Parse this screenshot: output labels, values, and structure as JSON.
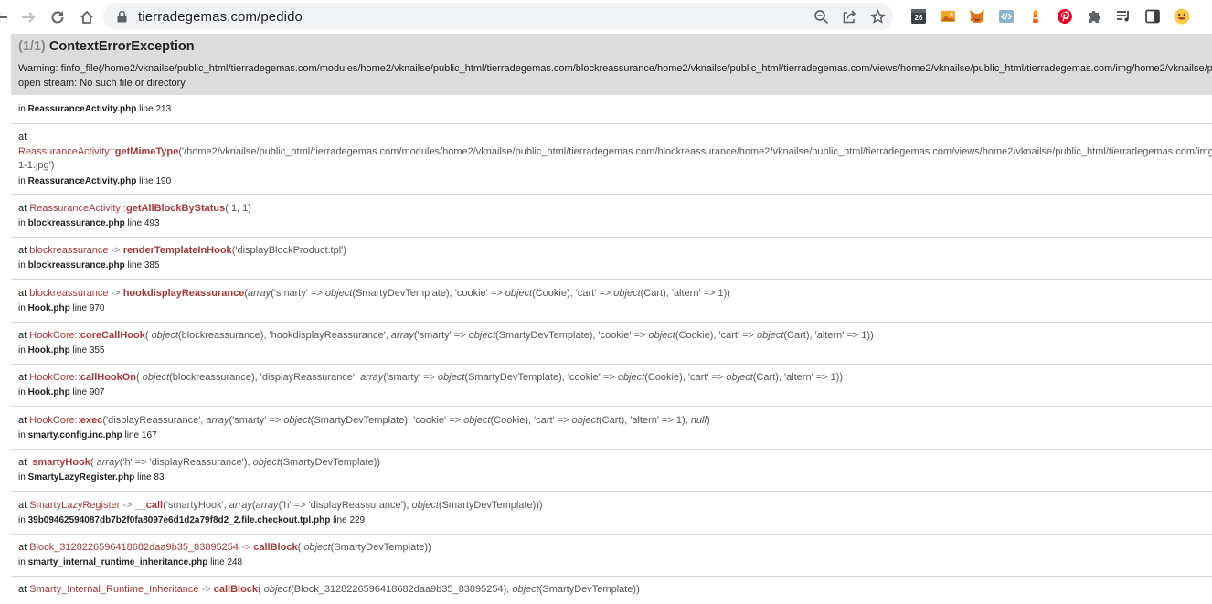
{
  "browser": {
    "url": "tierradegemas.com/pedido",
    "extensions": [
      "calendar-26-icon",
      "image-extension-icon",
      "metamask-fox-icon",
      "code-view-icon",
      "tower-extension-icon",
      "pinterest-icon",
      "puzzle-extensions-icon"
    ],
    "calendar_badge": "26"
  },
  "error": {
    "count": "(1/1)",
    "title": "ContextErrorException",
    "message_line1": "Warning: finfo_file(/home2/vknailse/public_html/tierradegemas.com/modules/home2/vknailse/public_html/tierradegemas.com/blockreassurance/home2/vknailse/public_html/tierradegemas.com/views/home2/vknailse/public_html/tierradegemas.com/img/home2/vknailse/public_html/tierradegemas.com/",
    "message_line2": "open stream: No such file or directory"
  },
  "trace": {
    "t0": {
      "in": "in",
      "file": "ReassuranceActivity.php",
      "line": "line 213"
    },
    "t1": {
      "at": "at",
      "cls": "ReassuranceActivity",
      "op": "::",
      "fn": "getMimeType",
      "args": "('/home2/vknailse/public_html/tierradegemas.com/modules/home2/vknailse/public_html/tierradegemas.com/blockreassurance/home2/vknailse/public_html/tierradegemas.com/views/home2/vknailse/public_html/tierradegemas.com/img/",
      "args2": "1-1.jpg')",
      "file": "ReassuranceActivity.php",
      "line": "line 190"
    },
    "t2": {
      "cls": "ReassuranceActivity",
      "op": "::",
      "fn": "getAllBlockByStatus",
      "args": "( 1, 1)",
      "file": "blockreassurance.php",
      "line": "line 493"
    },
    "t3": {
      "cls": "blockreassurance",
      "op": "->",
      "fn": "renderTemplateInHook",
      "args": "('displayBlockProduct.tpl')",
      "file": "blockreassurance.php",
      "line": "line 385"
    },
    "t4": {
      "cls": "blockreassurance",
      "op": "->",
      "fn": "hookdisplayReassurance",
      "a1": "(",
      "k1": "array",
      "a2": "('smarty' => ",
      "k2": "object",
      "a3": "(SmartyDevTemplate), 'cookie' => ",
      "k3": "object",
      "a4": "(Cookie), 'cart' => ",
      "k4": "object",
      "a5": "(Cart), 'altern' => 1))",
      "file": "Hook.php",
      "line": "line 970"
    },
    "t5": {
      "cls": "HookCore",
      "op": "::",
      "fn": "coreCallHook",
      "a1": "( ",
      "k1": "object",
      "a2": "(blockreassurance), 'hookdisplayReassurance', ",
      "k2": "array",
      "a3": "('smarty' => ",
      "k3": "object",
      "a4": "(SmartyDevTemplate), 'cookie' => ",
      "k4": "object",
      "a5": "(Cookie), 'cart' => ",
      "k5": "object",
      "a6": "(Cart), 'altern' => 1))",
      "file": "Hook.php",
      "line": "line 355"
    },
    "t6": {
      "cls": "HookCore",
      "op": "::",
      "fn": "callHookOn",
      "a1": "( ",
      "k1": "object",
      "a2": "(blockreassurance), 'displayReassurance', ",
      "k2": "array",
      "a3": "('smarty' => ",
      "k3": "object",
      "a4": "(SmartyDevTemplate), 'cookie' => ",
      "k4": "object",
      "a5": "(Cookie), 'cart' => ",
      "k5": "object",
      "a6": "(Cart), 'altern' => 1))",
      "file": "Hook.php",
      "line": "line 907"
    },
    "t7": {
      "cls": "HookCore",
      "op": "::",
      "fn": "exec",
      "a1": "('displayReassurance', ",
      "k1": "array",
      "a2": "('smarty' => ",
      "k2": "object",
      "a3": "(SmartyDevTemplate), 'cookie' => ",
      "k3": "object",
      "a4": "(Cookie), 'cart' => ",
      "k4": "object",
      "a5": "(Cart), 'altern' => 1), ",
      "k5": "null",
      "a6": ")",
      "file": "smarty.config.inc.php",
      "line": "line 167"
    },
    "t8": {
      "fn": "smartyHook",
      "a1": "( ",
      "k1": "array",
      "a2": "('h' => 'displayReassurance'), ",
      "k2": "object",
      "a3": "(SmartyDevTemplate))",
      "file": "SmartyLazyRegister.php",
      "line": "line 83"
    },
    "t9": {
      "cls": "SmartyLazyRegister",
      "op": "->",
      "fn": "__call",
      "a1": "('smartyHook', ",
      "k1": "array",
      "a2": "(",
      "k2": "array",
      "a3": "('h' => 'displayReassurance'), ",
      "k3": "object",
      "a4": "(SmartyDevTemplate)))",
      "file": "39b09462594087db7b2f0fa8097e6d1d2a79f8d2_2.file.checkout.tpl.php",
      "line": "line 229"
    },
    "t10": {
      "cls": "Block_3128226596418682daa9b35_83895254",
      "op": "->",
      "fn": "callBlock",
      "a1": "( ",
      "k1": "object",
      "a2": "(SmartyDevTemplate))",
      "file": "smarty_internal_runtime_inheritance.php",
      "line": "line 248"
    },
    "t11": {
      "cls": "Smarty_Internal_Runtime_Inheritance",
      "op": "->",
      "fn": "callBlock",
      "a1": "( ",
      "k1": "object",
      "a2": "(Block_3128226596418682daa9b35_83895254), ",
      "k2": "object",
      "a3": "(SmartyDevTemplate))"
    }
  }
}
